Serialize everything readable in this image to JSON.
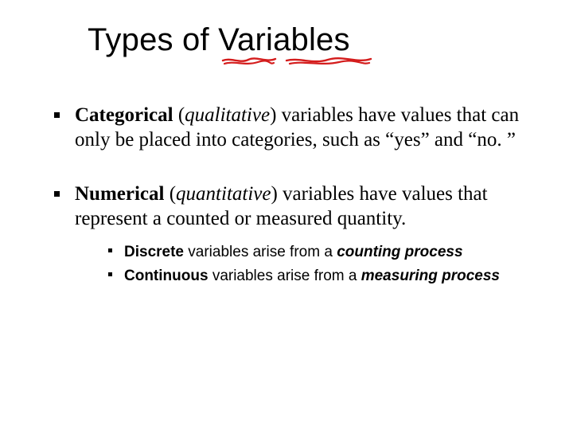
{
  "title": "Types of Variables",
  "bullets": [
    {
      "lead_bold": "Categorical ",
      "paren_open": "(",
      "paren_term": "qualitative",
      "paren_close": ") ",
      "rest": "variables have values that can only be placed into categories, such as “yes” and “no. ”"
    },
    {
      "lead_bold": "Numerical ",
      "paren_open": "(",
      "paren_term": "quantitative",
      "paren_close": ") ",
      "rest": "variables have values that represent a counted or measured quantity."
    }
  ],
  "sub_bullets": [
    {
      "lead_bold": "Discrete ",
      "mid": "variables arise from a ",
      "tail_bi": "counting process"
    },
    {
      "lead_bold": "Continuous ",
      "mid": "variables arise from a ",
      "tail_bi": "measuring process"
    }
  ]
}
